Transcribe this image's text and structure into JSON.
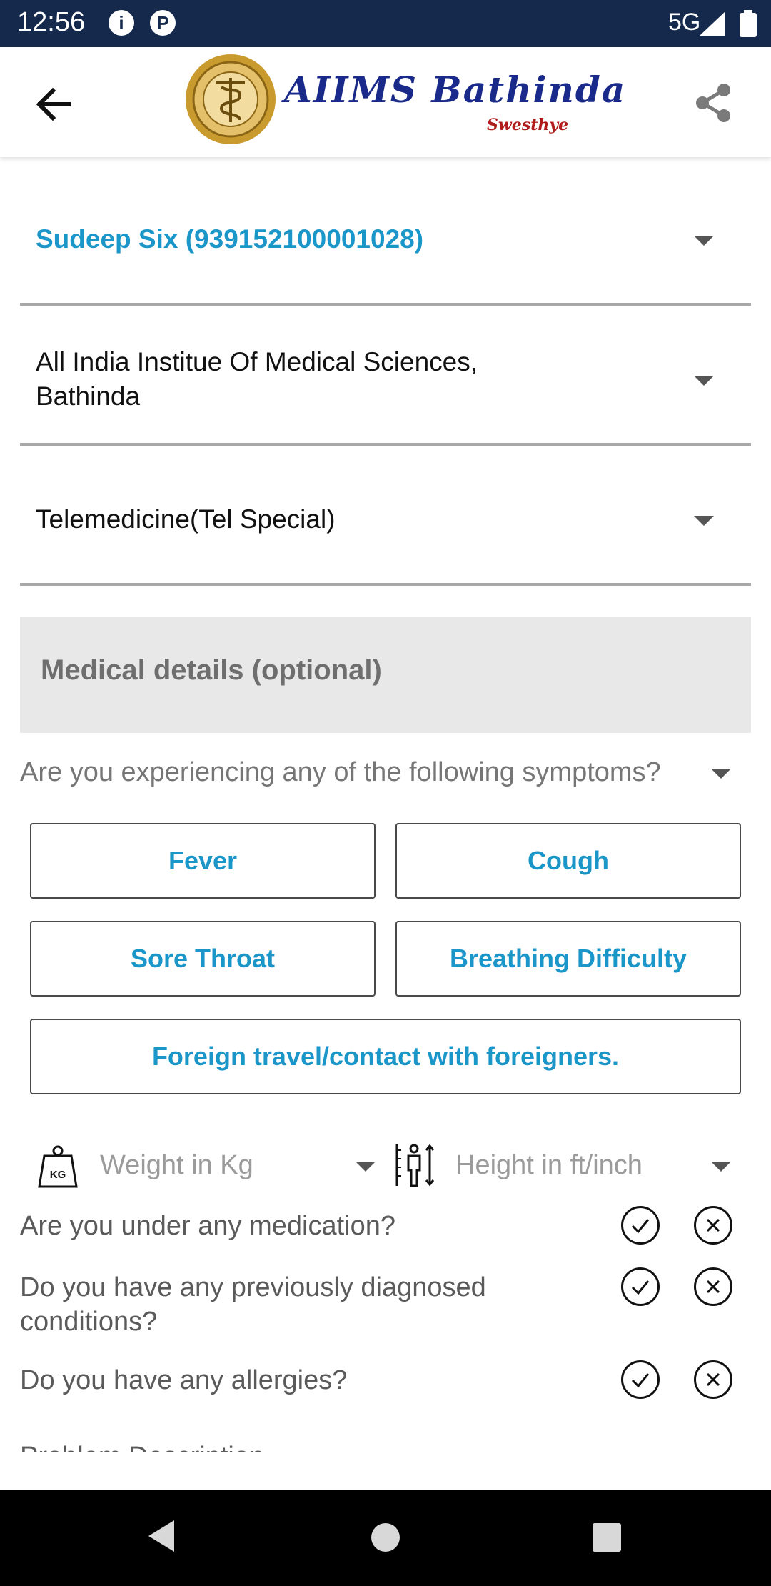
{
  "status_bar": {
    "time": "12:56",
    "network": "5G",
    "icons": [
      "info-icon",
      "app-badge-icon",
      "signal-icon",
      "battery-icon"
    ]
  },
  "header": {
    "title": "AIIMS Bathinda",
    "subtitle": "Swesthye",
    "back_icon": "arrow-left-icon",
    "share_icon": "share-icon"
  },
  "form": {
    "patient": "Sudeep Six (939152100001028)",
    "hospital_line1": "All India Institue Of Medical Sciences,",
    "hospital_line2": "Bathinda",
    "department": "Telemedicine(Tel Special)"
  },
  "medical": {
    "section_title": "Medical details (optional)",
    "symptoms_question": "Are you experiencing any of the following symptoms?",
    "symptoms": [
      "Fever",
      "Cough",
      "Sore Throat",
      "Breathing Difficulty",
      "Foreign travel/contact with foreigners."
    ],
    "weight_placeholder": "Weight in Kg",
    "weight_icon_label": "KG",
    "height_placeholder": "Height in ft/inch",
    "questions": [
      {
        "line1": "Are you under any medication?",
        "line2": ""
      },
      {
        "line1": "Do you have any previously diagnosed",
        "line2": "conditions?"
      },
      {
        "line1": "Do you have any allergies?",
        "line2": ""
      }
    ],
    "truncated_next_label": "Problem Description"
  },
  "colors": {
    "accent": "#1b96c8",
    "status_bar": "#14294b",
    "section_bg": "#e8e8e8",
    "logo_title": "#1a2a8a",
    "logo_subtitle": "#b01c1c"
  }
}
